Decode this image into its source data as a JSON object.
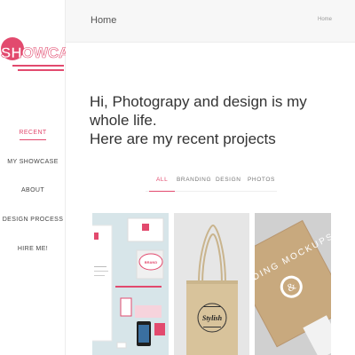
{
  "brand": {
    "logo_text": "SHOWCASE",
    "accent": "#e24a6e"
  },
  "sidebar": {
    "items": [
      {
        "label": "RECENT",
        "active": true
      },
      {
        "label": "MY SHOWCASE",
        "active": false
      },
      {
        "label": "ABOUT",
        "active": false
      },
      {
        "label": "DESIGN PROCESS",
        "active": false
      },
      {
        "label": "HIRE ME!",
        "active": false
      }
    ]
  },
  "header": {
    "title": "Home",
    "breadcrumb": "Home"
  },
  "intro": {
    "line1": "Hi, Photograpy and design is my whole life.",
    "line2": "Here are my recent projects"
  },
  "filters": [
    {
      "label": "ALL",
      "active": true
    },
    {
      "label": "BRANDING",
      "active": false
    },
    {
      "label": "DESIGN",
      "active": false
    },
    {
      "label": "PHOTOS",
      "active": false
    }
  ],
  "gallery": [
    {
      "name": "stationery-mockup",
      "stamp_text": "BRAND",
      "icon": "stationery-icon"
    },
    {
      "name": "tote-bag-mockup",
      "stamp_text": "Stylish",
      "icon": "tote-bag-icon"
    },
    {
      "name": "branding-mockups-card",
      "stamp_text": "BRANDING MOCKUPS",
      "icon": "card-icon"
    }
  ]
}
